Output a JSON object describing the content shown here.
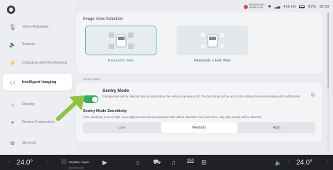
{
  "sidebar": {
    "items": [
      {
        "label": "Voice Assistant",
        "icon": "microphone-icon"
      },
      {
        "label": "Sounds",
        "icon": "speaker-icon"
      },
      {
        "label": "Charging and Discharging",
        "icon": "charging-icon"
      },
      {
        "label": "Intelligent Imaging",
        "icon": "camera-icon",
        "active": true
      },
      {
        "label": "Display",
        "icon": "sun-icon"
      },
      {
        "label": "Device Connection",
        "icon": "link-icon"
      },
      {
        "label": "General",
        "icon": "gear-icon"
      }
    ]
  },
  "status": {
    "airbag_line1": "PASSENGER",
    "airbag_line2": "AIRBAG ON",
    "range": "416 km",
    "battery": "81%",
    "time": "18:53"
  },
  "image_view": {
    "title": "Image View Selection",
    "options": [
      {
        "label": "Panoramic View",
        "selected": true
      },
      {
        "label": "Panoramic + Hub View",
        "selected": false
      }
    ]
  },
  "sentry": {
    "section_label": "Sentry Mode",
    "title": "Sentry Mode",
    "enabled": true,
    "description": "Emergencies will be detected and recorded when the vehicle is powered off. The recordings will be sent to the mobile phone immediately with notifications.",
    "sensitivity_title": "Sentry Mode Sensitivity",
    "sensitivity_desc": "If the sensitivity is set to high, even slight movements and potential risks will be detected. If it is set to low, only risky events will be detected",
    "sensitivity_options": [
      "Low",
      "Medium",
      "High"
    ],
    "sensitivity_selected": "Medium"
  },
  "dock": {
    "left_temp": "24.0°",
    "right_temp": "24.0°",
    "media_title": "Anytime, Anyw..",
    "media_sub": "Second Audio",
    "fan_label": "360"
  },
  "colors": {
    "accent": "#2f9f88",
    "toggle_on": "#2fae62",
    "arrow": "#8cc63f",
    "dock_bg": "#1f2125"
  }
}
